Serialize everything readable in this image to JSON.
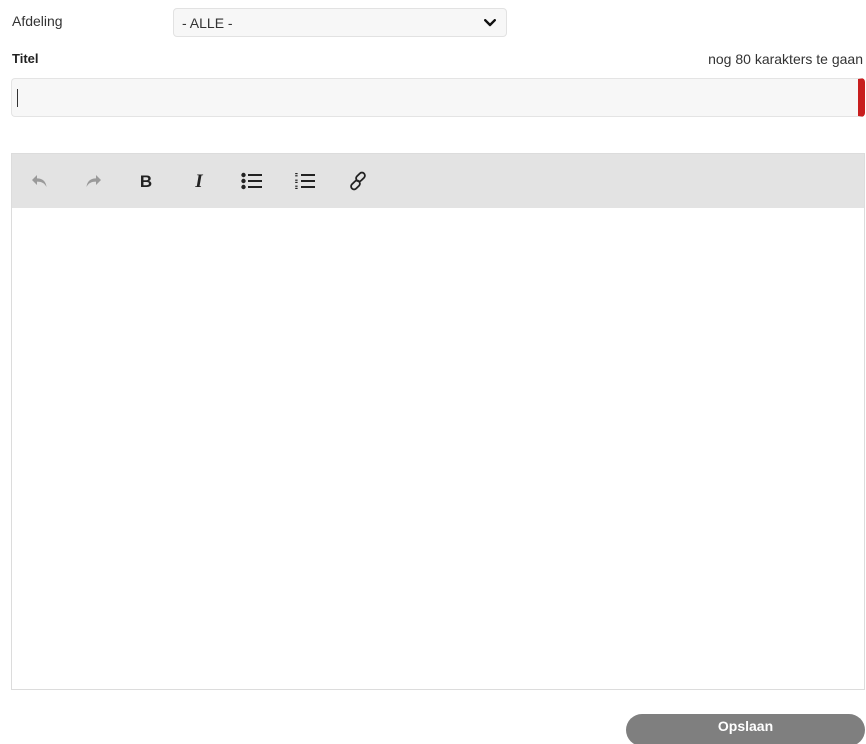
{
  "form": {
    "department_label": "Afdeling",
    "department_value": "- ALLE -",
    "title_label": "Titel",
    "title_counter": "nog 80 karakters te gaan",
    "title_value": ""
  },
  "editor": {
    "toolbar": [
      {
        "name": "undo",
        "icon": "undo-icon"
      },
      {
        "name": "redo",
        "icon": "redo-icon"
      },
      {
        "name": "bold",
        "icon": "bold-icon"
      },
      {
        "name": "italic",
        "icon": "italic-icon"
      },
      {
        "name": "bullet-list",
        "icon": "bullet-list-icon"
      },
      {
        "name": "numbered-list",
        "icon": "numbered-list-icon"
      },
      {
        "name": "link",
        "icon": "link-icon"
      }
    ],
    "content": ""
  },
  "actions": {
    "save_label": "Opslaan"
  },
  "colors": {
    "error_accent": "#c81e1e",
    "toolbar_bg": "#e3e3e3",
    "button_bg": "#7f7f7f"
  }
}
